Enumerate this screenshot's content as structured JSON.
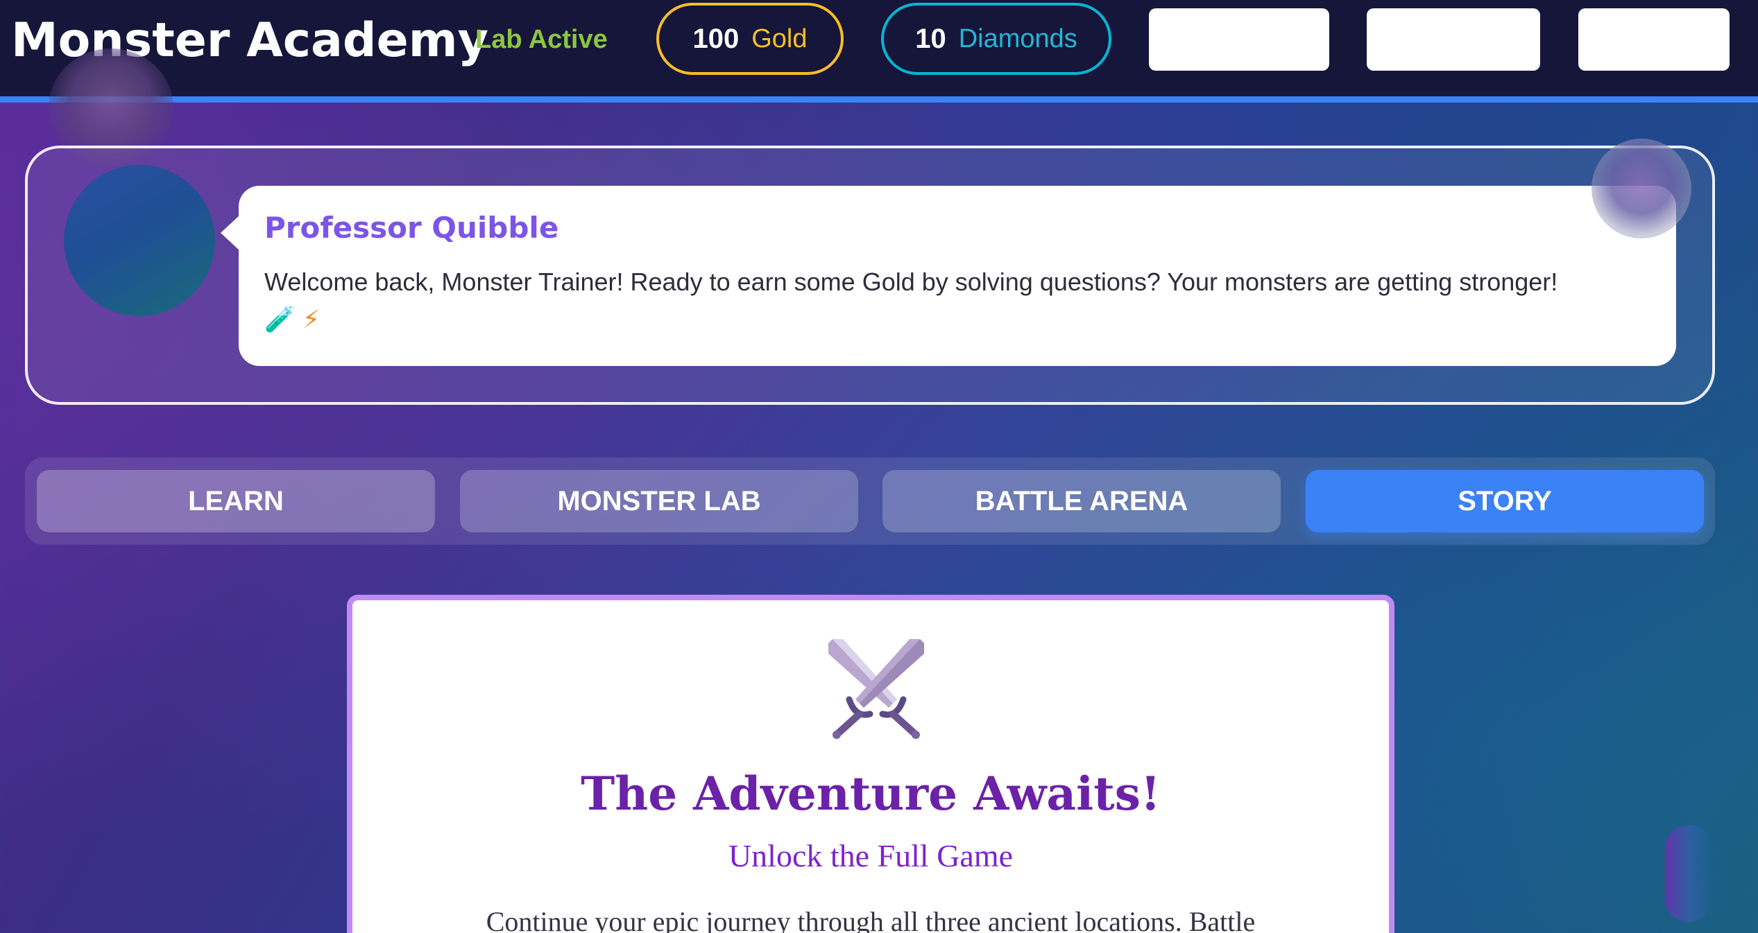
{
  "header": {
    "title": "Monster Academy",
    "lab_status": "Lab Active",
    "gold": {
      "amount": "100",
      "label": "Gold"
    },
    "diamonds": {
      "amount": "10",
      "label": "Diamonds"
    },
    "blank_buttons": [
      "",
      "",
      ""
    ]
  },
  "professor": {
    "name": "Professor Quibble",
    "message": "Welcome back, Monster Trainer! Ready to earn some Gold by solving questions? Your monsters are getting stronger!",
    "emoji": [
      "🧪",
      "⚡"
    ]
  },
  "tabs": [
    {
      "label": "LEARN",
      "active": false
    },
    {
      "label": "MONSTER LAB",
      "active": false
    },
    {
      "label": "BATTLE ARENA",
      "active": false
    },
    {
      "label": "STORY",
      "active": true
    }
  ],
  "story_card": {
    "icon": "crossed-swords-icon",
    "title": "The Adventure Awaits!",
    "subtitle": "Unlock the Full Game",
    "body": "Continue your epic journey through all three ancient locations. Battle"
  },
  "colors": {
    "header_bg": "#15163a",
    "accent_blue": "#3b82f6",
    "gold": "#fbbf24",
    "diamond": "#06b6d4",
    "lab_active": "#8cc63f",
    "professor_name": "#7c55e6",
    "card_border": "#c08af5",
    "title_purple": "#6b21a8"
  }
}
